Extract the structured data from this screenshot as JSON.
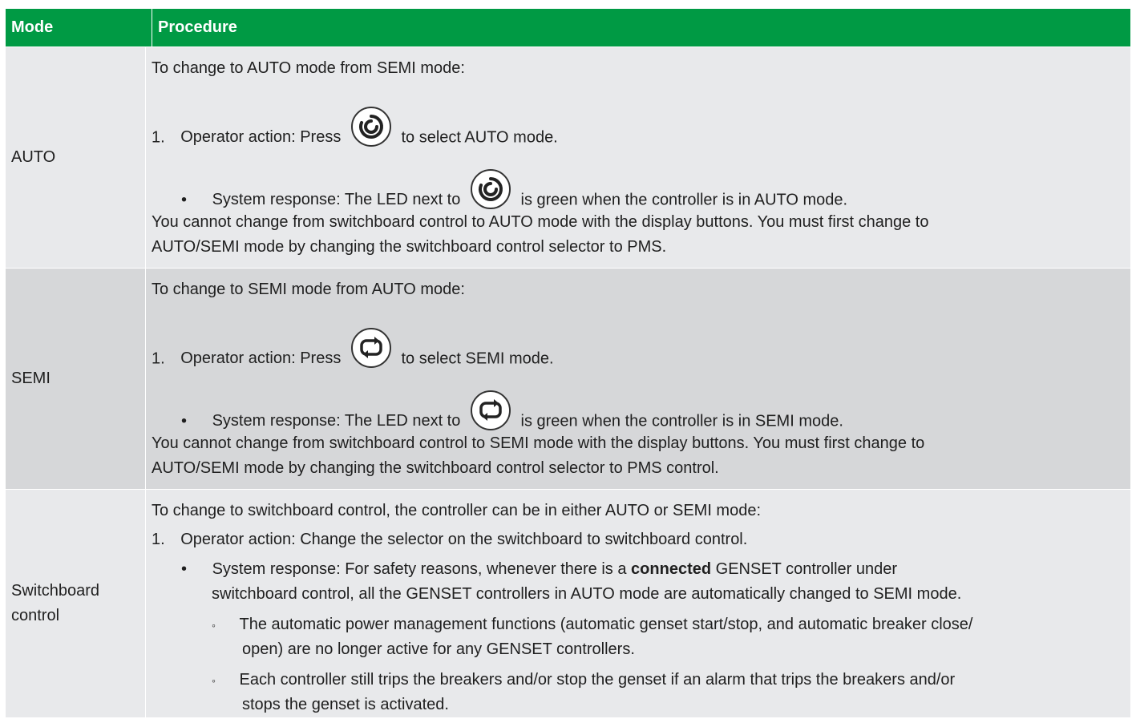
{
  "header": {
    "mode": "Mode",
    "procedure": "Procedure"
  },
  "rows": [
    {
      "mode": "AUTO",
      "intro": "To change to AUTO mode from SEMI mode:",
      "step_num": "1.",
      "step_pre": "Operator action: Press",
      "step_post": "to select AUTO mode.",
      "bullet": "•",
      "resp_pre": "System response: The LED next to",
      "resp_post": "is green when the controller is in AUTO mode.",
      "note1": "You cannot change from switchboard control to AUTO mode with the display buttons. You must first change to",
      "note2": "AUTO/SEMI mode by changing the switchboard control selector to PMS.",
      "icon": "auto-mode-icon"
    },
    {
      "mode": "SEMI",
      "intro": "To change to SEMI mode from AUTO mode:",
      "step_num": "1.",
      "step_pre": "Operator action: Press",
      "step_post": "to select SEMI mode.",
      "bullet": "•",
      "resp_pre": "System response: The LED next to",
      "resp_post": "is green when the controller is in SEMI mode.",
      "note1": "You cannot change from switchboard control to SEMI mode with the display buttons. You must first change to",
      "note2": "AUTO/SEMI mode by changing the switchboard control selector to PMS control.",
      "icon": "semi-mode-icon"
    },
    {
      "mode_l1": "Switchboard",
      "mode_l2": "control",
      "intro": "To change to switchboard control, the controller can be in either AUTO or SEMI mode:",
      "step_num": "1.",
      "step": "Operator action: Change the selector on the switchboard to switchboard control.",
      "bullet": "•",
      "resp_a": "System response: For safety reasons, whenever there is a",
      "resp_bold": "connected",
      "resp_b": "GENSET controller under",
      "resp_l2": "switchboard control, all the GENSET controllers in AUTO mode are automatically changed to SEMI mode.",
      "sub_bullet": "◦",
      "sub1_l1": "The automatic power management functions (automatic genset start/stop, and automatic breaker close/",
      "sub1_l2": "open) are no longer active for any GENSET controllers.",
      "sub2_l1": "Each controller still trips the breakers and/or stop the genset if an alarm that trips the breakers and/or",
      "sub2_l2": "stops the genset is activated."
    }
  ],
  "colors": {
    "header": "#009a44",
    "row_light": "#e8e9eb",
    "row_dark": "#d6d7d9"
  }
}
